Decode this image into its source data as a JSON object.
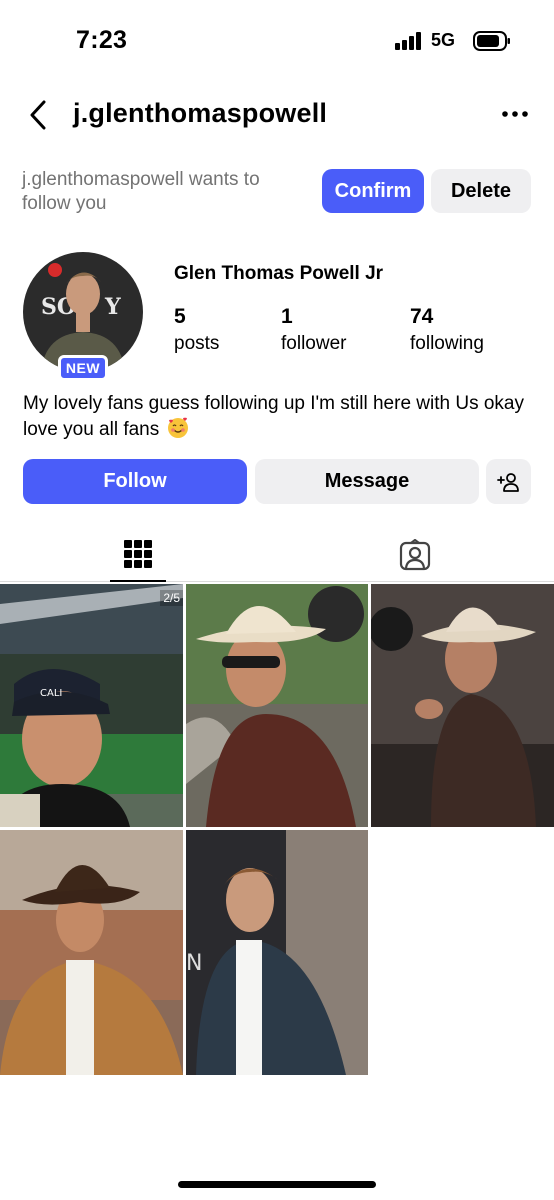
{
  "status_bar": {
    "time": "7:23",
    "network": "5G"
  },
  "header": {
    "username": "j.glenthomaspowell"
  },
  "follow_request": {
    "text": "j.glenthomaspowell wants to follow you",
    "confirm_label": "Confirm",
    "delete_label": "Delete"
  },
  "profile": {
    "avatar_badge": "NEW",
    "full_name": "Glen Thomas Powell Jr",
    "stats": [
      {
        "value": "5",
        "label": "posts"
      },
      {
        "value": "1",
        "label": "follower"
      },
      {
        "value": "74",
        "label": "following"
      }
    ],
    "bio": "My lovely fans guess following up I'm still here with Us okay love you all fans"
  },
  "actions": {
    "follow_label": "Follow",
    "message_label": "Message"
  },
  "tabs": [
    {
      "icon": "grid-icon",
      "active": true
    },
    {
      "icon": "tagged-icon",
      "active": false
    }
  ],
  "posts": [
    {
      "description": "stadium selfie with cap",
      "multi_label": "2/5"
    },
    {
      "description": "cowboy hat with sunglasses"
    },
    {
      "description": "cowboy hat in vehicle pointing"
    },
    {
      "description": "cowboy hat suede jacket stadium"
    },
    {
      "description": "dark jacket portrait"
    }
  ],
  "colors": {
    "accent": "#4a5df9",
    "button_gray": "#efeff1",
    "muted_text": "#737373"
  }
}
